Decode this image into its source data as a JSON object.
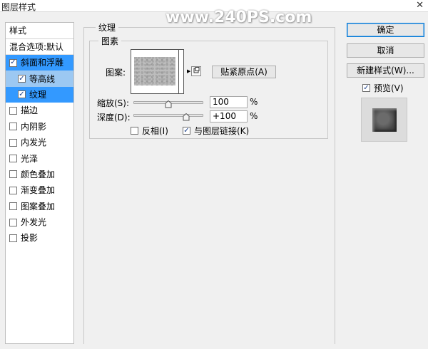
{
  "window": {
    "title": "图层样式",
    "close_glyph": "✕"
  },
  "watermark": "www.240PS.com",
  "style_list": {
    "header": "样式",
    "blend_options": "混合选项:默认",
    "items": [
      {
        "label": "斜面和浮雕",
        "checked": true,
        "sub": false
      },
      {
        "label": "等高线",
        "checked": true,
        "sub": true
      },
      {
        "label": "纹理",
        "checked": true,
        "sub": true
      },
      {
        "label": "描边",
        "checked": false,
        "sub": false
      },
      {
        "label": "内阴影",
        "checked": false,
        "sub": false
      },
      {
        "label": "内发光",
        "checked": false,
        "sub": false
      },
      {
        "label": "光泽",
        "checked": false,
        "sub": false
      },
      {
        "label": "颜色叠加",
        "checked": false,
        "sub": false
      },
      {
        "label": "渐变叠加",
        "checked": false,
        "sub": false
      },
      {
        "label": "图案叠加",
        "checked": false,
        "sub": false
      },
      {
        "label": "外发光",
        "checked": false,
        "sub": false
      },
      {
        "label": "投影",
        "checked": false,
        "sub": false
      }
    ]
  },
  "texture": {
    "group_title": "纹理",
    "pattern_group_title": "图素",
    "pattern_label": "图案:",
    "snap_button": "贴紧原点(A)",
    "scale_label": "缩放(S):",
    "scale_value": "100",
    "scale_unit": "%",
    "scale_level": 0.5,
    "depth_label": "深度(D):",
    "depth_value": "+100",
    "depth_unit": "%",
    "depth_level": 0.75,
    "invert_label": "反相(I)",
    "invert_checked": false,
    "link_label": "与图层链接(K)",
    "link_checked": true
  },
  "buttons": {
    "ok": "确定",
    "cancel": "取消",
    "new_style": "新建样式(W)...",
    "preview_label": "预览(V)",
    "preview_checked": true
  },
  "colors": {
    "selection": "#3399ff",
    "sub_selection": "#9cc8f2"
  },
  "icons": {
    "checkbox_checked": "✓",
    "dropdown": "▶"
  }
}
